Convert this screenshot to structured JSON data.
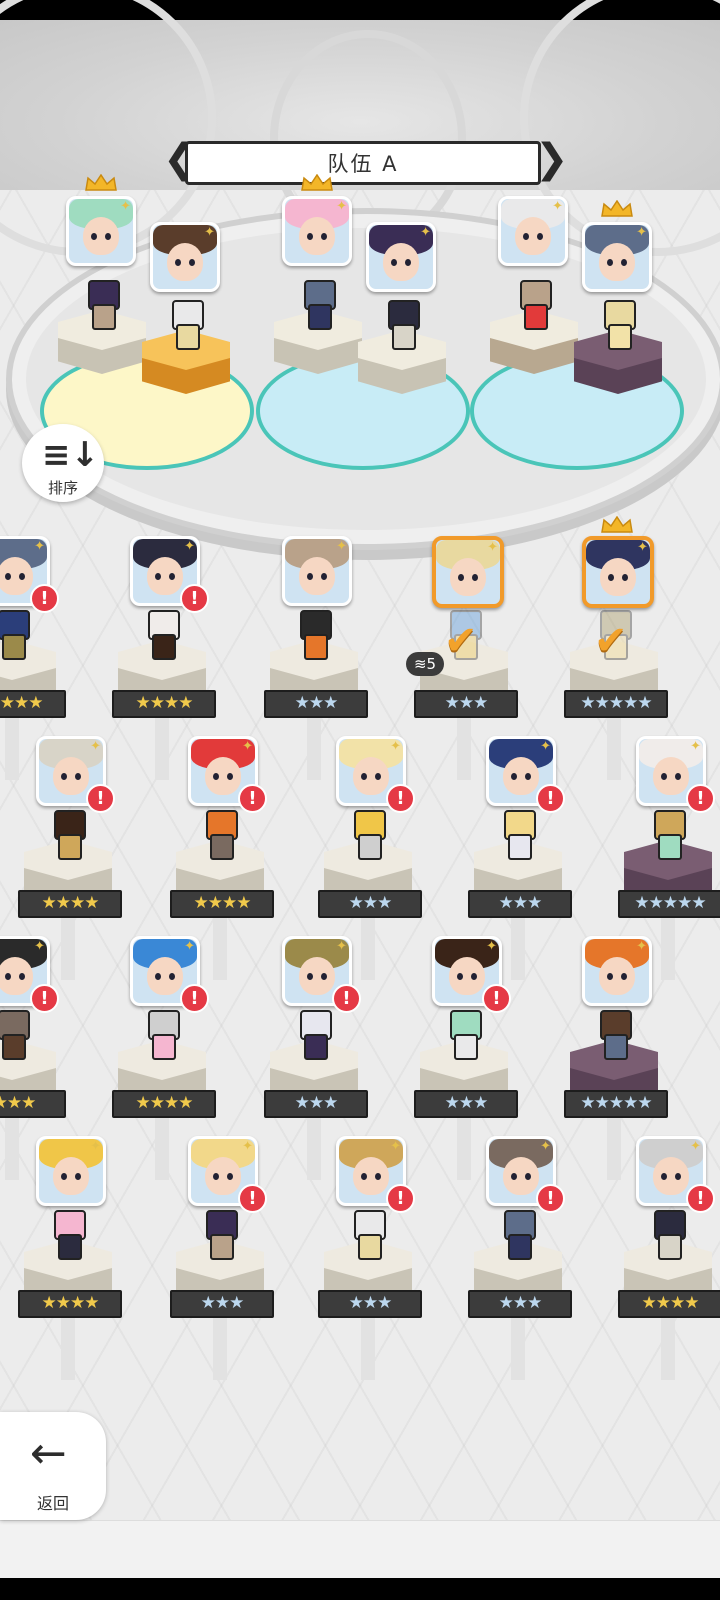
{
  "team": {
    "title": "队伍 A",
    "prev_glyph": "❮",
    "next_glyph": "❯"
  },
  "sort_button": {
    "label": "排序",
    "icon": "sort-descending-icon"
  },
  "back_button": {
    "label": "返回",
    "icon": "arrow-left-icon"
  },
  "colors": {
    "gold_star": "#f0c94b",
    "silver_star": "#bcd7ee",
    "alert_red": "#e53945",
    "selected_border": "#f19a2a"
  },
  "team_slots": [
    {
      "leader": true,
      "glow": "yellow"
    },
    {
      "leader": false,
      "glow": "yellow"
    },
    {
      "leader": true,
      "glow": "blue"
    },
    {
      "leader": false,
      "glow": "blue"
    },
    {
      "leader": false,
      "glow": "blue"
    },
    {
      "leader": true,
      "glow": "blue"
    }
  ],
  "roster": [
    {
      "stars": "★★★★",
      "rarity": "gold",
      "alert": true
    },
    {
      "stars": "★★★★",
      "rarity": "gold",
      "alert": true
    },
    {
      "stars": "★★★",
      "rarity": "silver",
      "alert": false
    },
    {
      "stars": "★★★",
      "rarity": "silver",
      "alert": false,
      "selected": true,
      "count": "5"
    },
    {
      "stars": "★★★★★",
      "rarity": "silver",
      "alert": false,
      "selected": true,
      "leader": true
    },
    {
      "stars": "★★★★",
      "rarity": "gold",
      "alert": true
    },
    {
      "stars": "★★★★",
      "rarity": "gold",
      "alert": true
    },
    {
      "stars": "★★★",
      "rarity": "silver",
      "alert": true
    },
    {
      "stars": "★★★",
      "rarity": "silver",
      "alert": true
    },
    {
      "stars": "★★★★★",
      "rarity": "silver",
      "alert": true
    },
    {
      "stars": "★★★",
      "rarity": "gold",
      "alert": true
    },
    {
      "stars": "★★★★",
      "rarity": "gold",
      "alert": true
    },
    {
      "stars": "★★★",
      "rarity": "silver",
      "alert": true
    },
    {
      "stars": "★★★",
      "rarity": "silver",
      "alert": true
    },
    {
      "stars": "★★★★★",
      "rarity": "silver",
      "alert": false
    },
    {
      "stars": "★★★★",
      "rarity": "gold",
      "alert": false
    },
    {
      "stars": "★★★",
      "rarity": "silver",
      "alert": true
    },
    {
      "stars": "★★★",
      "rarity": "silver",
      "alert": true
    },
    {
      "stars": "★★★",
      "rarity": "silver",
      "alert": true
    },
    {
      "stars": "★★★★",
      "rarity": "gold",
      "alert": true
    }
  ]
}
